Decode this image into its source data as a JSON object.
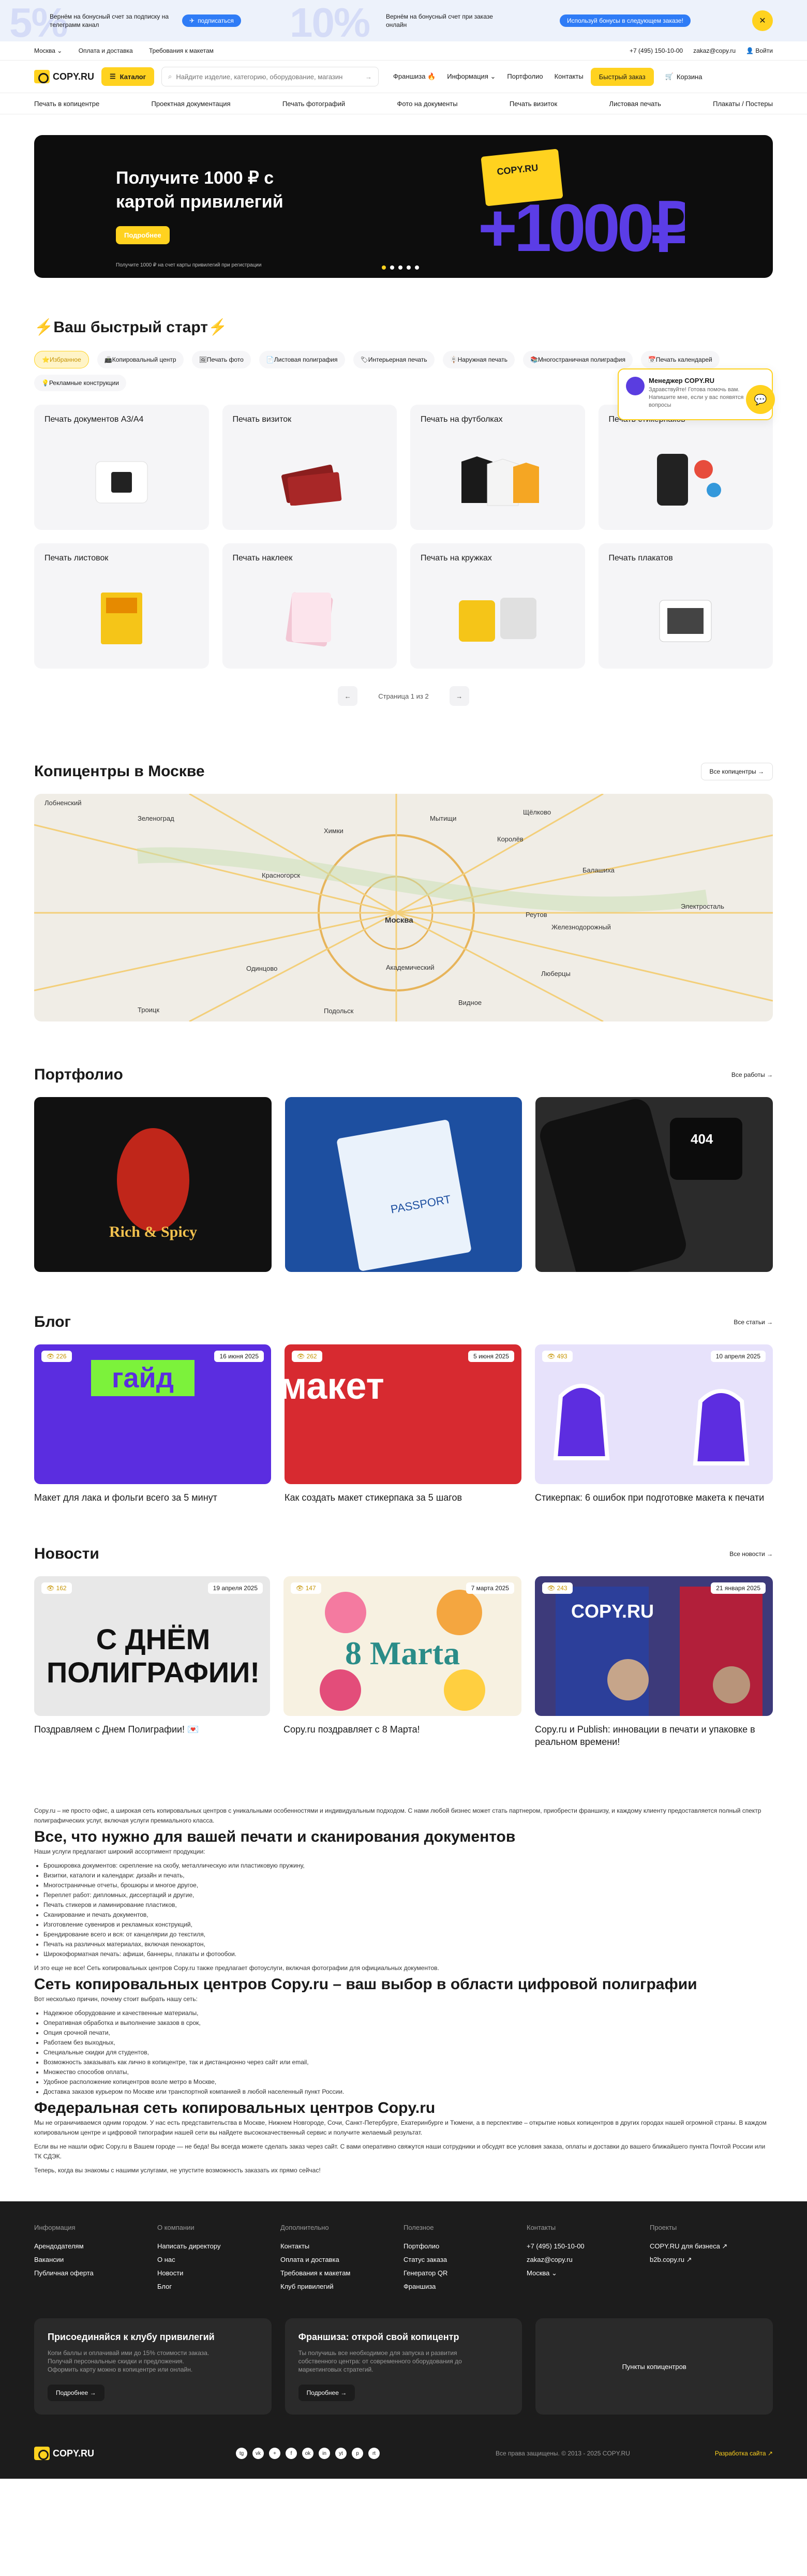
{
  "promo": {
    "big1": "5%",
    "big2": "10%",
    "item1_text": "Вернём на бонусный счет за подписку на телеграмм канал",
    "item1_btn": "подписаться",
    "item2_text": "Вернём на бонусный счет при заказе онлайн",
    "item2_btn": "Используй бонусы в следующем заказе!"
  },
  "topbar": {
    "city": "Москва",
    "links": [
      "Оплата и доставка",
      "Требования к макетам"
    ],
    "phone": "+7 (495) 150-10-00",
    "email": "zakaz@copy.ru",
    "login": "Войти"
  },
  "header": {
    "logo": "COPY.RU",
    "catalog": "Каталог",
    "search_placeholder": "Найдите изделие, категорию, оборудование, магазин",
    "nav": [
      "Франшиза",
      "Информация",
      "Портфолио",
      "Контакты"
    ],
    "quick_order": "Быстрый заказ",
    "cart": "Корзина"
  },
  "catnav": [
    "Печать в копицентре",
    "Проектная документация",
    "Печать фотографий",
    "Фото на документы",
    "Печать визиток",
    "Листовая печать",
    "Плакаты / Постеры"
  ],
  "hero": {
    "title": "Получите 1000 ₽ с картой привилегий",
    "button": "Подробнее",
    "note": "Получите 1000 ₽ на счет карты привилегий при регистрации",
    "card_text": "COPY.RU",
    "amount": "+1000₽"
  },
  "quickstart": {
    "title": "⚡Ваш быстрый старт⚡",
    "tabs": [
      "⭐Избранное",
      "📠Копировальный центр",
      "🖼Печать фото",
      "📄Листовая полиграфия",
      "🏷Интерьерная печать",
      "🪧Наружная печать",
      "📚Многостраничная полиграфия",
      "📅Печать календарей",
      "💡Рекламные конструкции"
    ],
    "cards": [
      "Печать документов А3/А4",
      "Печать визиток",
      "Печать на футболках",
      "Печать стикерпаков",
      "Печать листовок",
      "Печать наклеек",
      "Печать на кружках",
      "Печать плакатов"
    ],
    "pager": "Страница 1 из 2"
  },
  "manager": {
    "title": "Менеджер COPY.RU",
    "text": "Здравствуйте! Готова помочь вам. Напишите мне, если у вас появятся вопросы"
  },
  "centers": {
    "title": "Копицентры в Москве",
    "button": "Все копицентры",
    "places": [
      "Лобненский",
      "Мытищи",
      "Химки",
      "Щёлково",
      "Королёв",
      "Красногорск",
      "Балашиха",
      "Москва",
      "Реутов",
      "Одинцово",
      "Люберцы",
      "Видное",
      "Академический",
      "Железнодорожный",
      "Троицк",
      "Зеленоград",
      "Электросталь",
      "Подольск"
    ]
  },
  "portfolio": {
    "title": "Портфолио",
    "link": "Все работы",
    "overlay1": "Rich & Spicy",
    "overlay2": "PASSPORT",
    "overlay3": "404"
  },
  "blog": {
    "title": "Блог",
    "link": "Все статьи",
    "items": [
      {
        "views": "226",
        "date": "16 июня 2025",
        "title": "Макет для лака и фольги всего за 5 минут",
        "img": "гайд"
      },
      {
        "views": "262",
        "date": "5 июня 2025",
        "title": "Как создать макет стикерпака за 5 шагов",
        "img": "макет"
      },
      {
        "views": "493",
        "date": "10 апреля 2025",
        "title": "Стикерпак: 6 ошибок при подготовке макета к печати",
        "img": ""
      }
    ]
  },
  "news": {
    "title": "Новости",
    "link": "Все новости",
    "items": [
      {
        "views": "162",
        "date": "19 апреля 2025",
        "title": "Поздравляем с Днем Полиграфии! 💌",
        "img": "С ДНЁМ ПОЛИГРАФИИ!"
      },
      {
        "views": "147",
        "date": "7 марта 2025",
        "title": "Copy.ru поздравляет с 8 Марта!",
        "img": "8 Marta"
      },
      {
        "views": "243",
        "date": "21 января 2025",
        "title": "Copy.ru и Publish: инновации в печати и упаковке в реальном времени!",
        "img": "COPY.RU"
      }
    ]
  },
  "seo": {
    "intro": "Copy.ru – не просто офис, а широкая сеть копировальных центров с уникальными особенностями и индивидуальным подходом. С нами любой бизнес может стать партнером, приобрести франшизу, и каждому клиенту предоставляется полный спектр полиграфических услуг, включая услуги премиального класса.",
    "h1": "Все, что нужно для вашей печати и сканирования документов",
    "lead": "Наши услуги предлагают широкий ассортимент продукции:",
    "list1": [
      "Брошюровка документов: скрепление на скобу, металлическую или пластиковую пружину,",
      "Визитки, каталоги и календари: дизайн и печать,",
      "Многостраничные отчеты, брошюры и многое другое,",
      "Переплет работ: дипломных, диссертаций и другие,",
      "Печать стикеров и ламинирование пластиков,",
      "Сканирование и печать документов,",
      "Изготовление сувениров и рекламных конструкций,",
      "Брендирование всего и вся: от канцелярии до текстиля,",
      "Печать на различных материалах, включая пенокартон,",
      "Широкоформатная печать: афиши, баннеры, плакаты и фотообои."
    ],
    "after1": "И это еще не все! Сеть копировальных центров Copy.ru также предлагает фотоуслуги, включая фотографии для официальных документов.",
    "h2": "Сеть копировальных центров Copy.ru – ваш выбор в области цифровой полиграфии",
    "lead2": "Вот несколько причин, почему стоит выбрать нашу сеть:",
    "list2": [
      "Надежное оборудование и качественные материалы,",
      "Оперативная обработка и выполнение заказов в срок,",
      "Опция срочной печати,",
      "Работаем без выходных,",
      "Специальные скидки для студентов,",
      "Возможность заказывать как лично в копицентре, так и дистанционно через сайт или email,",
      "Множество способов оплаты,",
      "Удобное расположение копицентров возле метро в Москве,",
      "Доставка заказов курьером по Москве или транспортной компанией в любой населенный пункт России."
    ],
    "h3": "Федеральная сеть копировальных центров Copy.ru",
    "p3": "Мы не ограничиваемся одним городом. У нас есть представительства в Москве, Нижнем Новгороде, Сочи, Санкт-Петербурге, Екатеринбурге и Тюмени, а в перспективе – открытие новых копицентров в других городах нашей огромной страны. В каждом копировальном центре и цифровой типографии нашей сети вы найдете высококачественный сервис и получите желаемый результат.",
    "p4": "Если вы не нашли офис Copy.ru в Вашем городе — не беда! Вы всегда можете сделать заказ через сайт. С вами оперативно свяжутся наши сотрудники и обсудят все условия заказа, оплаты и доставки до вашего ближайшего пункта Почтой России или ТК СДЭК.",
    "p5": "Теперь, когда вы знакомы с нашими услугами, не упустите возможность заказать их прямо сейчас!"
  },
  "footer": {
    "cols": [
      {
        "title": "Информация",
        "items": [
          "Арендодателям",
          "Вакансии",
          "Публичная оферта"
        ]
      },
      {
        "title": "О компании",
        "items": [
          "Написать директору",
          "О нас",
          "Новости",
          "Блог"
        ]
      },
      {
        "title": "Дополнительно",
        "items": [
          "Контакты",
          "Оплата и доставка",
          "Требования к макетам",
          "Клуб привилегий"
        ]
      },
      {
        "title": "Полезное",
        "items": [
          "Портфолио",
          "Статус заказа",
          "Генератор QR",
          "Франшиза"
        ]
      },
      {
        "title": "Контакты",
        "items": [
          "+7 (495) 150-10-00",
          "zakaz@copy.ru",
          "Москва"
        ]
      },
      {
        "title": "Проекты",
        "items": [
          "COPY.RU для бизнеса ↗",
          "b2b.copy.ru ↗"
        ]
      }
    ],
    "card1": {
      "title": "Присоединяйся к клубу привилегий",
      "text": "Копи баллы и оплачивай ими до 15% стоимости заказа. Получай персональные скидки и предложения. Оформить карту можно в копицентре или онлайн.",
      "btn": "Подробнее"
    },
    "card2": {
      "title": "Франшиза: открой свой копицентр",
      "text": "Ты получишь все необходимое для запуска и развития собственного центра: от современного оборудования до маркетинговых стратегий.",
      "btn": "Подробнее"
    },
    "card3": {
      "title": "Пункты копицентров"
    },
    "copyright": "Все права защищены. © 2013 - 2025 COPY.RU",
    "dev": "Разработка сайта ↗",
    "social": [
      "tg",
      "vk",
      "+",
      "f",
      "ok",
      "in",
      "yt",
      "p",
      "rt"
    ]
  }
}
